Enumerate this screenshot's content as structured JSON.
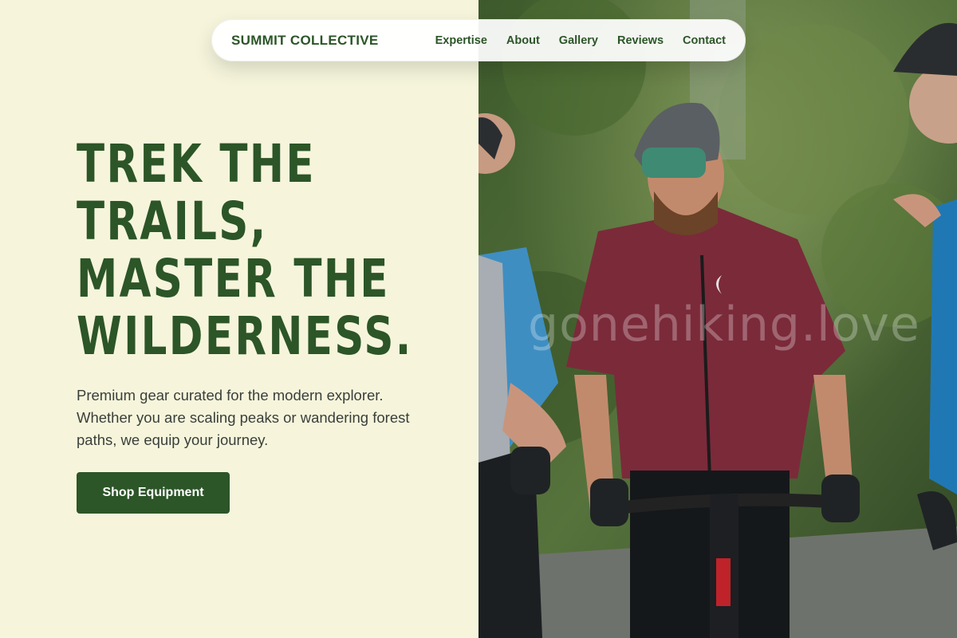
{
  "nav": {
    "brand": "SUMMIT COLLECTIVE",
    "links": [
      "Expertise",
      "About",
      "Gallery",
      "Reviews",
      "Contact"
    ]
  },
  "hero": {
    "headline_lines": [
      "TREK THE",
      "TRAILS,",
      "MASTER THE",
      "WILDERNESS."
    ],
    "subtext": "Premium gear curated for the modern explorer. Whether you are scaling peaks or wandering forest paths, we equip your journey.",
    "cta_label": "Shop Equipment",
    "photo_watermark": "gonehiking.love"
  },
  "colors": {
    "brand_green": "#2c5528",
    "background_cream": "#f6f5dc",
    "button_text": "#ffffff",
    "body_text": "#3a3f3a"
  }
}
